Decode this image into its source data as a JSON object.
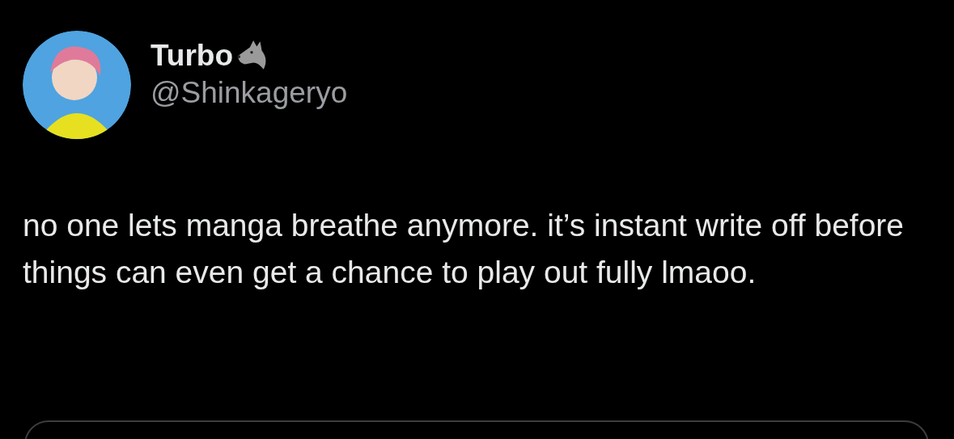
{
  "author": {
    "display_name": "Turbo",
    "handle": "@Shinkageryo"
  },
  "tweet": {
    "text": "no one lets manga breathe anymore. it’s instant write off before things can even get a chance to play out fully lmaoo."
  },
  "quoted_card": {
    "kind": "card"
  }
}
